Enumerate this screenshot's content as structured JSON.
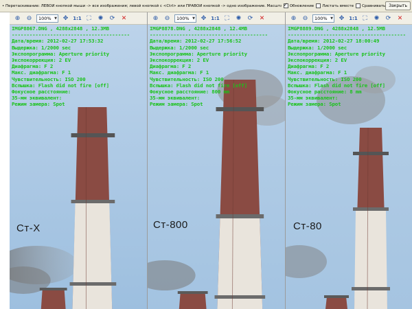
{
  "topbar": {
    "hint": "• Перетаскивание: ЛЕВОЙ кнопкой мыши -> все изображения; левой кнопкой с <Ctrl> или ПРАВОЙ кнопкой -> одно изображение. Масштаб:",
    "checkboxes": [
      {
        "label": "Обновление",
        "checked": true
      },
      {
        "label": "Листать вместе",
        "checked": false
      },
      {
        "label": "Сравнивать",
        "checked": false
      }
    ],
    "close_label": "Закрыть"
  },
  "toolbar": {
    "zoom_value": "100%",
    "one_to_one": "1:1",
    "icons": [
      "zoom-in-icon",
      "zoom-out-icon",
      "fit-icon",
      "one-to-one",
      "fullscreen-icon",
      "histogram-icon",
      "rotate-icon",
      "close-icon"
    ]
  },
  "panes": [
    {
      "file": "IMGP8867.DNG  ,  4288x2848  ,  12.3MB",
      "separator": "----------------------------------------",
      "lines": [
        "Дата/время: 2012-02-27 17:53:32",
        "Выдержка: 1/2000 sec",
        "Экспопрограмма: Aperture priority",
        "Экспокоррекция: 2 EV",
        "Диафрагма: F 2",
        "Макс. диафрагма: F 1",
        "Чувствительность: ISO 200",
        "Вспышка: Flash did not fire [off]",
        "Фокусное расстояние:",
        "35-мм эквивалент:",
        "Режим замера: Spot"
      ],
      "label": "Ст-Х"
    },
    {
      "file": "IMGP8878.DNG  ,  4288x2848  ,  12.4MB",
      "separator": "----------------------------------------",
      "lines": [
        "Дата/время: 2012-02-27 17:56:52",
        "Выдержка: 1/2000 sec",
        "Экспопрограмма: Aperture priority",
        "Экспокоррекция: 2 EV",
        "Диафрагма: F 2",
        "Макс. диафрагма: F 1",
        "Чувствительность: ISO 200",
        "Вспышка: Flash did not fire [off]",
        "Фокусное расстояние: 800 mm",
        "35-мм эквивалент:",
        "Режим замера: Spot"
      ],
      "label": "Ст-800"
    },
    {
      "file": "IMGP8889.DNG  ,  4288x2848  ,  12.5MB",
      "separator": "----------------------------------------",
      "lines": [
        "Дата/время: 2012-02-27 18:00:49",
        "Выдержка: 1/2000 sec",
        "Экспопрограмма: Aperture priority",
        "Экспокоррекция: 2 EV",
        "Диафрагма: F 2",
        "Макс. диафрагма: F 1",
        "Чувствительность: ISO 200",
        "Вспышка: Flash did not fire [off]",
        "Фокусное расстояние: 8 mm",
        "35-мм эквивалент:",
        "Режим замера: Spot"
      ],
      "label": "Ст-80"
    }
  ],
  "colors": {
    "info_text": "#1bc21b",
    "sky": "#a9c7e3",
    "chimney_red": "#8a4b43",
    "chimney_white": "#e9e4dc"
  }
}
